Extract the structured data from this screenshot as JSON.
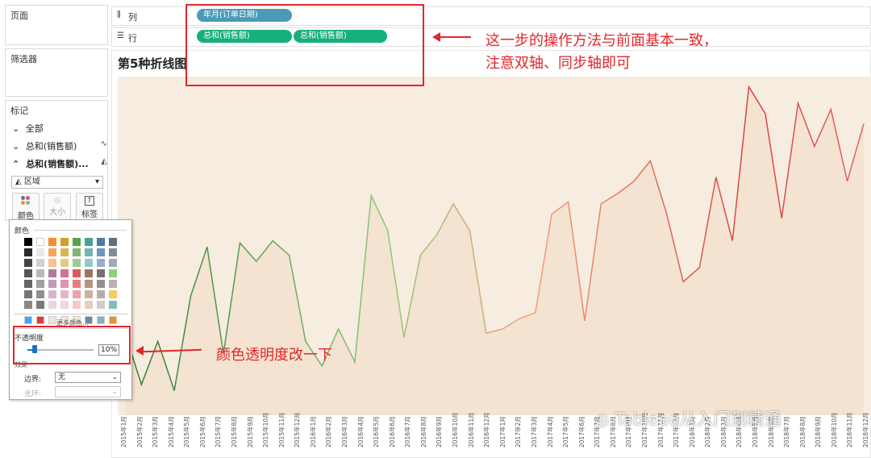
{
  "left": {
    "pages_title": "页面",
    "filters_title": "筛选器",
    "marks": {
      "title": "标记",
      "all_label": "全部",
      "row1_label": "总和(销售额)",
      "row2_label": "总和(销售额)...",
      "mark_type": "区域",
      "buttons": [
        {
          "label": "颜色",
          "icon": "color-dots-icon"
        },
        {
          "label": "大小",
          "icon": "size-icon"
        },
        {
          "label": "标签",
          "icon": "text-label-icon"
        }
      ]
    }
  },
  "shelves": {
    "columns_label": "列",
    "rows_label": "行",
    "columns_pill": "年月(订单日期)",
    "rows_pills": [
      "总和(销售额)",
      "总和(销售额)"
    ]
  },
  "view": {
    "title": "第5种折线图"
  },
  "color_popup": {
    "section_color": "颜色",
    "more_colors": "更多颜色...",
    "opacity_label": "不透明度",
    "opacity_value": "10%",
    "opacity_fraction": 0.1,
    "effects_label": "效果",
    "border_label": "边界:",
    "border_value": "无",
    "halo_label": "光环:",
    "halo_value": ""
  },
  "annotations": {
    "top_line1": "这一步的操作方法与前面基本一致，",
    "top_line2": "注意双轴、同步轴即可",
    "opacity_note": "颜色透明度改一下",
    "watermark": "Tableau从入门到精通"
  },
  "chart_data": {
    "type": "area",
    "title": "第5种折线图",
    "x": [
      "2015年1月",
      "2015年2月",
      "2015年3月",
      "2015年4月",
      "2015年5月",
      "2015年6月",
      "2015年7月",
      "2015年8月",
      "2015年9月",
      "2015年10月",
      "2015年11月",
      "2015年12月",
      "2016年1月",
      "2016年2月",
      "2016年3月",
      "2016年4月",
      "2016年5月",
      "2016年6月",
      "2016年7月",
      "2016年8月",
      "2016年9月",
      "2016年10月",
      "2016年11月",
      "2016年12月",
      "2017年1月",
      "2017年2月",
      "2017年3月",
      "2017年4月",
      "2017年5月",
      "2017年6月",
      "2017年7月",
      "2017年8月",
      "2017年9月",
      "2017年10月",
      "2017年11月",
      "2017年12月",
      "2018年1月",
      "2018年2月",
      "2018年3月",
      "2018年4月",
      "2018年5月",
      "2018年6月",
      "2018年7月",
      "2018年8月",
      "2018年9月",
      "2018年10月",
      "2018年11月",
      "2018年12月"
    ],
    "values": [
      40,
      15,
      36,
      12,
      58,
      82,
      30,
      84,
      75,
      85,
      78,
      36,
      24,
      42,
      26,
      107,
      90,
      38,
      78,
      88,
      103,
      90,
      40,
      42,
      47,
      50,
      98,
      104,
      46,
      103,
      108,
      114,
      124,
      98,
      65,
      72,
      116,
      85,
      160,
      147,
      96,
      152,
      131,
      149,
      114,
      142
    ],
    "series_values_note": "",
    "ylim": [
      0,
      165
    ]
  }
}
